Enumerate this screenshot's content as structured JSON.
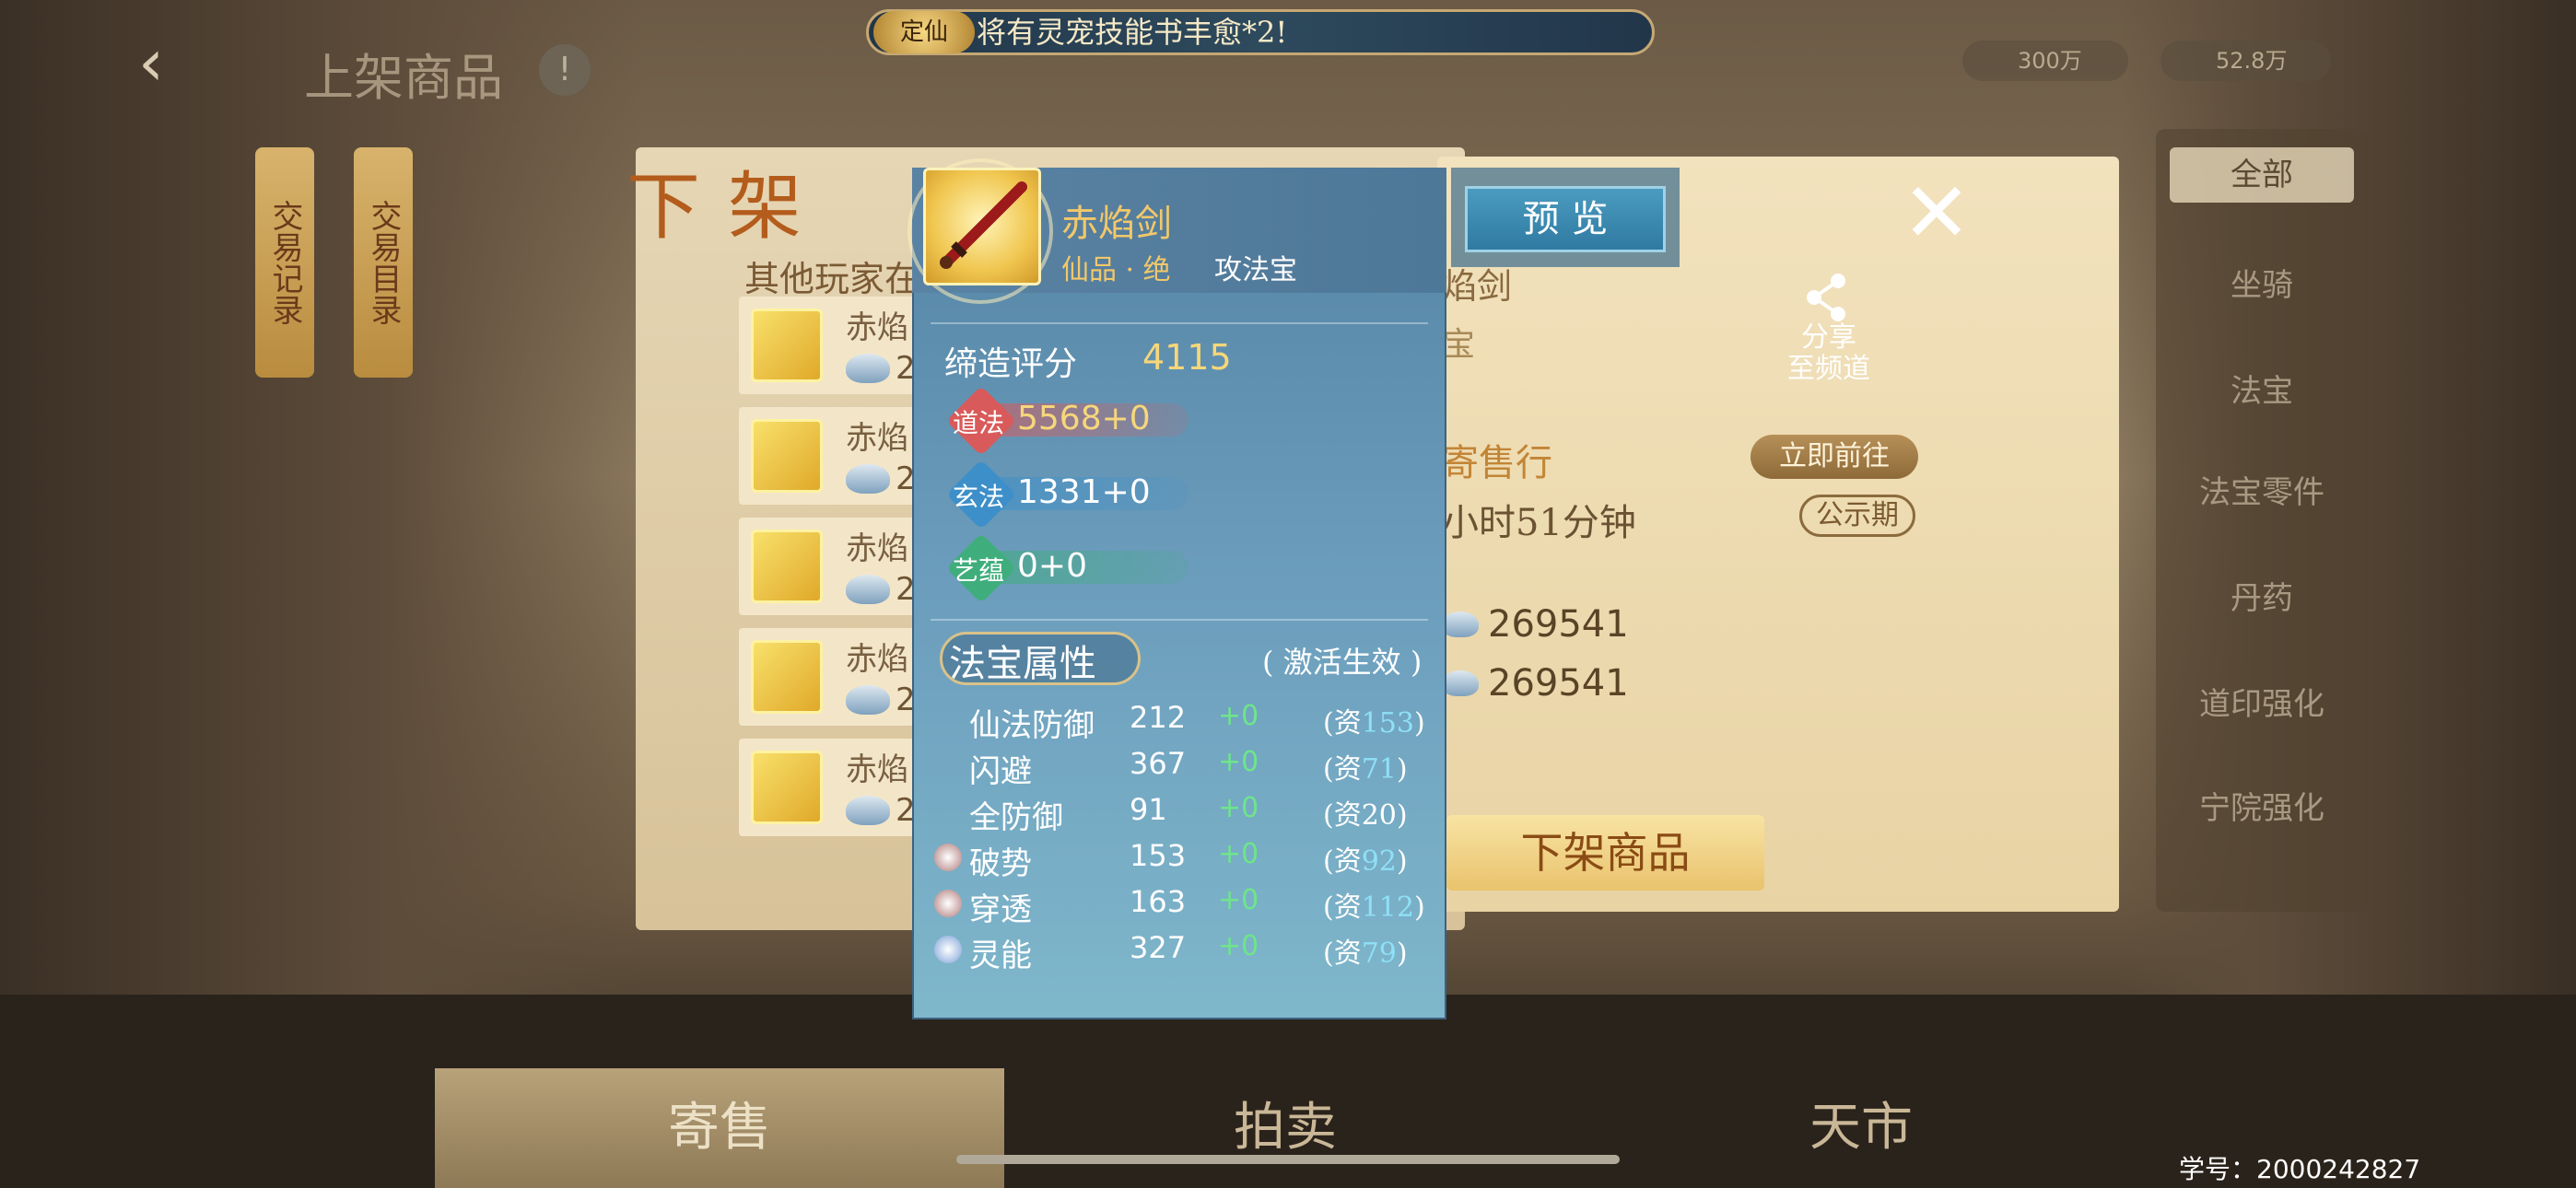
{
  "notice": {
    "badge": "定仙",
    "text": "将有灵宠技能书丰愈*2!"
  },
  "header": {
    "back": "‹",
    "title": "上架商品",
    "help": "!"
  },
  "currency": {
    "a": "300万",
    "b": "52.8万"
  },
  "banners": [
    "交易记录",
    "交易目录"
  ],
  "right_menu": [
    "全部",
    "坐骑",
    "法宝",
    "法宝零件",
    "丹药",
    "道印强化",
    "宁院强化"
  ],
  "list": {
    "title": "下架",
    "label": "其他玩家在",
    "rows": [
      {
        "name": "赤焰",
        "price": "2"
      },
      {
        "name": "赤焰",
        "price": "2"
      },
      {
        "name": "赤焰",
        "price": "2"
      },
      {
        "name": "赤焰",
        "price": "2"
      },
      {
        "name": "赤焰",
        "price": "2"
      }
    ]
  },
  "detail": {
    "name": "焰剑",
    "type": "宝",
    "share": "分享\n至频道",
    "close": "✕",
    "shop_label": "寄售行",
    "goto": "立即前往",
    "time": "小时51分钟",
    "public": "公示期",
    "price1": "269541",
    "price2": "269541",
    "delist": "下架商品"
  },
  "tooltip": {
    "name": "赤焰剑",
    "grade": "仙品 · 绝",
    "type": "攻法宝",
    "preview": "预 览",
    "score_label": "缔造评分",
    "score": "4115",
    "bars": [
      {
        "gem": "道法",
        "text": "5568+0",
        "color": "#d95a5a",
        "fill": 0.55
      },
      {
        "gem": "玄法",
        "text": "1331+0",
        "color": "#3d8fc9",
        "fill": 0.35
      },
      {
        "gem": "艺蕴",
        "text": "0+0",
        "color": "#3fae7c",
        "fill": 0.02
      }
    ],
    "attr_title": "法宝属性",
    "attr_hint": "( 激活生效 )",
    "attrs": [
      {
        "name": "仙法防御",
        "val": "212",
        "add": "+0",
        "apt_prefix": "(资",
        "apt": "153",
        "apt_suffix": ")",
        "rune": ""
      },
      {
        "name": "闪避",
        "val": "367",
        "add": "+0",
        "apt_prefix": "(资",
        "apt": "71",
        "apt_suffix": ")",
        "rune": ""
      },
      {
        "name": "全防御",
        "val": "91",
        "add": "+0",
        "apt_prefix": "(资",
        "apt": "20",
        "apt_suffix": ")",
        "rune": ""
      },
      {
        "name": "破势",
        "val": "153",
        "add": "+0",
        "apt_prefix": "(资",
        "apt": "92",
        "apt_suffix": ")",
        "rune": "#b07a7a"
      },
      {
        "name": "穿透",
        "val": "163",
        "add": "+0",
        "apt_prefix": "(资",
        "apt": "112",
        "apt_suffix": ")",
        "rune": "#b07a7a"
      },
      {
        "name": "灵能",
        "val": "327",
        "add": "+0",
        "apt_prefix": "(资",
        "apt": "79",
        "apt_suffix": ")",
        "rune": "#7aa0d8"
      }
    ]
  },
  "tabs": [
    "寄售",
    "拍卖",
    "天市"
  ],
  "student_id": "学号：2000242827"
}
